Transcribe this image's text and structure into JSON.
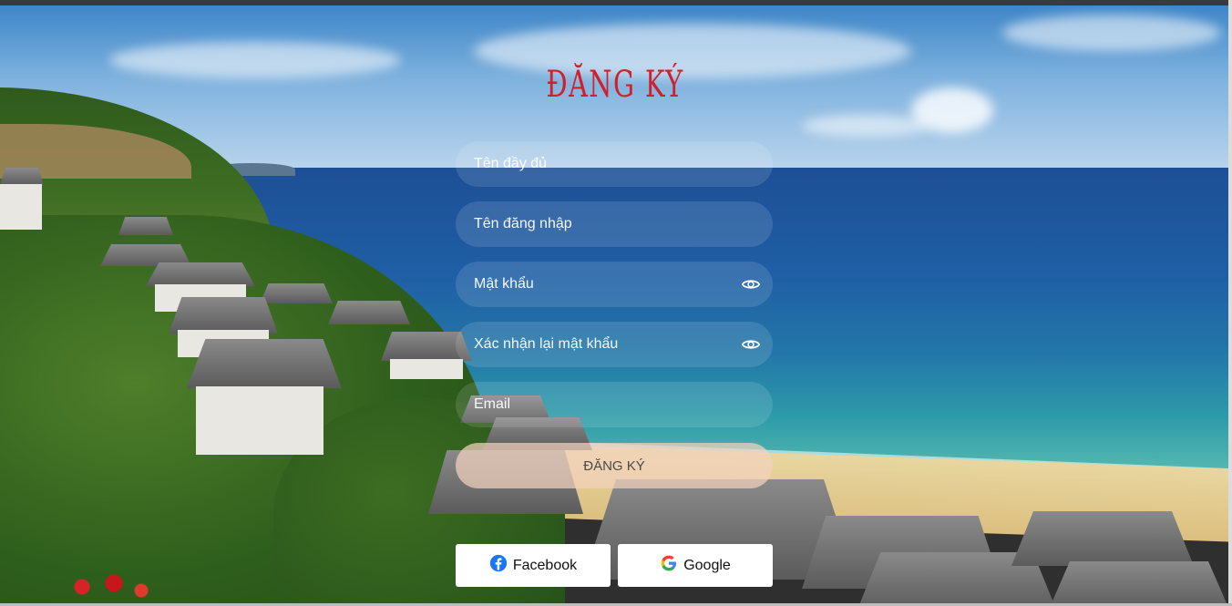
{
  "form": {
    "title": "ĐĂNG KÝ",
    "fields": {
      "full_name": {
        "placeholder": "Tên đầy đủ"
      },
      "username": {
        "placeholder": "Tên đăng nhập"
      },
      "password": {
        "placeholder": "Mật khẩu"
      },
      "confirm_password": {
        "placeholder": "Xác nhận lại mật khẩu"
      },
      "email": {
        "placeholder": "Email"
      }
    },
    "submit_label": "ĐĂNG KÝ"
  },
  "social": {
    "facebook_label": "Facebook",
    "google_label": "Google"
  },
  "icons": {
    "password_toggle": "eye-icon",
    "facebook": "facebook-icon",
    "google": "google-icon"
  },
  "colors": {
    "title": "#d0202a",
    "facebook": "#1877f2",
    "submit_bg": "#f2d2be"
  }
}
